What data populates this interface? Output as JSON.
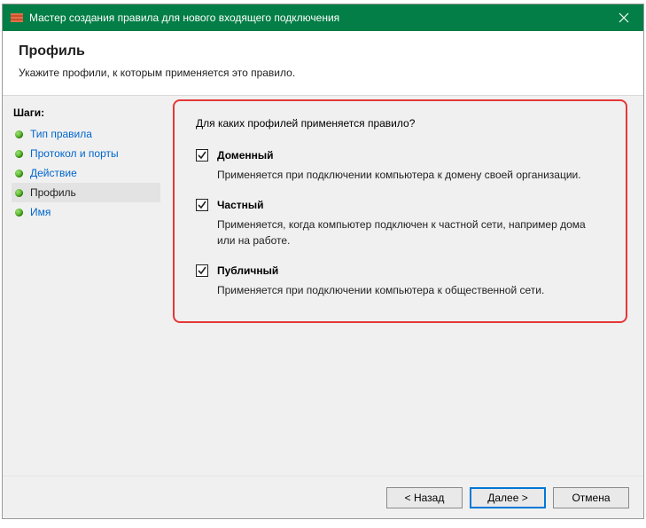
{
  "window": {
    "title": "Мастер создания правила для нового входящего подключения"
  },
  "header": {
    "title": "Профиль",
    "subtitle": "Укажите профили, к которым применяется это правило."
  },
  "sidebar": {
    "steps_label": "Шаги:",
    "items": [
      {
        "label": "Тип правила"
      },
      {
        "label": "Протокол и порты"
      },
      {
        "label": "Действие"
      },
      {
        "label": "Профиль"
      },
      {
        "label": "Имя"
      }
    ]
  },
  "main": {
    "question": "Для каких профилей применяется правило?",
    "options": [
      {
        "label": "Доменный",
        "desc": "Применяется при подключении компьютера к домену своей организации.",
        "checked": true
      },
      {
        "label": "Частный",
        "desc": "Применяется, когда компьютер подключен к частной сети, например дома или на работе.",
        "checked": true
      },
      {
        "label": "Публичный",
        "desc": "Применяется при подключении компьютера к общественной сети.",
        "checked": true
      }
    ]
  },
  "footer": {
    "back": "< Назад",
    "next": "Далее >",
    "cancel": "Отмена"
  }
}
